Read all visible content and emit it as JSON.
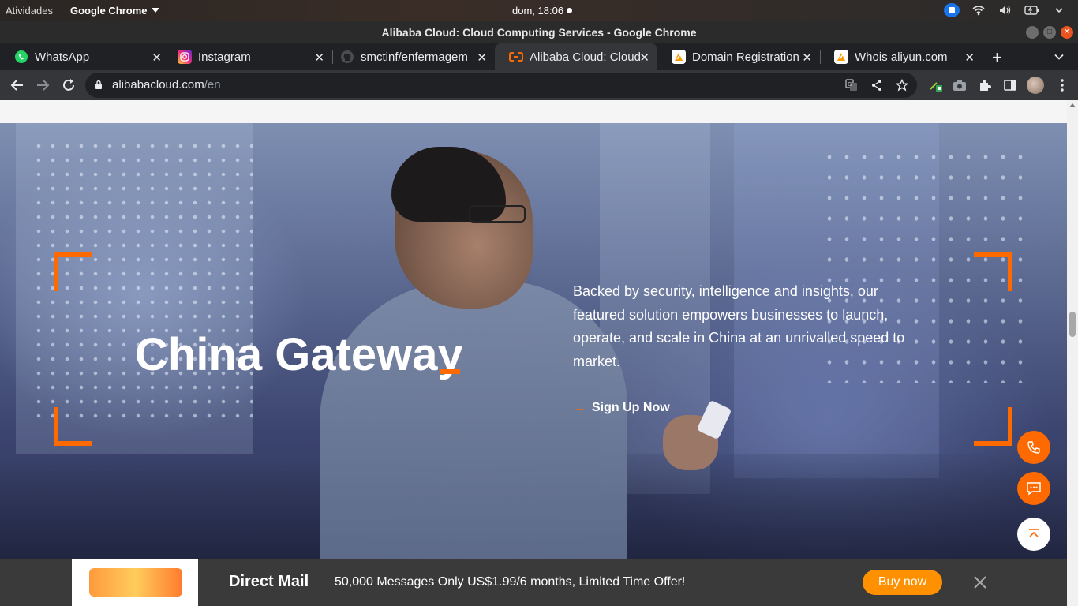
{
  "gnome": {
    "activities": "Atividades",
    "app_name": "Google Chrome",
    "clock": "dom, 18:06"
  },
  "window": {
    "title": "Alibaba Cloud: Cloud Computing Services - Google Chrome"
  },
  "tabs": [
    {
      "label": "WhatsApp",
      "icon": "whatsapp-icon",
      "active": false
    },
    {
      "label": "Instagram",
      "icon": "instagram-icon",
      "active": false
    },
    {
      "label": "smctinf/enfermagem",
      "icon": "github-icon",
      "active": false
    },
    {
      "label": "Alibaba Cloud: Cloud",
      "icon": "alibaba-icon",
      "active": true
    },
    {
      "label": "Domain Registration",
      "icon": "aliyun-icon",
      "active": false
    },
    {
      "label": "Whois aliyun.com",
      "icon": "aliyun-icon",
      "active": false
    }
  ],
  "toolbar": {
    "url_host": "alibabacloud.com",
    "url_path": "/en"
  },
  "hero": {
    "title": "China Gateway",
    "description": "Backed by security, intelligence and insights, our featured solution empowers businesses to launch, operate, and scale in China at an unrivalled speed to market.",
    "cta": "Sign Up Now"
  },
  "banner": {
    "brand": "Direct Mail",
    "message": "50,000 Messages Only US$1.99/6 months, Limited Time Offer!",
    "button": "Buy now"
  },
  "colors": {
    "accent": "#ff6a00",
    "buy_button": "#ff9100",
    "tab_bg": "#202124",
    "toolbar_bg": "#35363a"
  }
}
